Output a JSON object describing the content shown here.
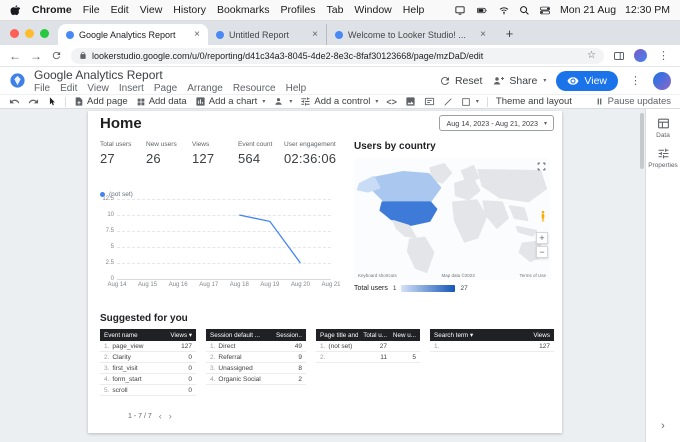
{
  "theme": {
    "accent_blue": "#1a73e8",
    "chart_line": "#4285f4",
    "map_us": "#3e7bd8",
    "map_canada": "#aac8ef",
    "map_alaska": "#c9dcf5",
    "map_land": "#e3e5e8",
    "table_header_bg": "#202124"
  },
  "menubar": {
    "items": [
      "Chrome",
      "File",
      "Edit",
      "View",
      "History",
      "Bookmarks",
      "Profiles",
      "Tab",
      "Window",
      "Help"
    ],
    "date": "Mon 21 Aug",
    "time": "12:30 PM"
  },
  "browser": {
    "tabs": [
      {
        "title": "Google Analytics Report"
      },
      {
        "title": "Untitled Report"
      },
      {
        "title": "Welcome to Looker Studio! ..."
      }
    ],
    "url": "lookerstudio.google.com/u/0/reporting/d41c34a3-8045-4de2-8e3c-8faf30123668/page/mzDaD/edit"
  },
  "header": {
    "title": "Google Analytics Report",
    "menus": [
      "File",
      "Edit",
      "View",
      "Insert",
      "Page",
      "Arrange",
      "Resource",
      "Help"
    ],
    "reset_label": "Reset",
    "share_label": "Share",
    "view_label": "View"
  },
  "toolbar": {
    "add_page": "Add page",
    "add_data": "Add data",
    "add_chart": "Add a chart",
    "add_control": "Add a control",
    "theme_layout": "Theme and layout",
    "pause_updates": "Pause updates"
  },
  "canvas": {
    "page_title": "Home",
    "date_range": "Aug 14, 2023 - Aug 21, 2023"
  },
  "scorecards": [
    {
      "label": "Total users",
      "value": "27"
    },
    {
      "label": "New users",
      "value": "26"
    },
    {
      "label": "Views",
      "value": "127"
    },
    {
      "label": "Event count",
      "value": "564"
    },
    {
      "label": "User engagement",
      "value": "02:36:06"
    }
  ],
  "map": {
    "title": "Users by country",
    "legend_label": "Total users",
    "legend_min": "1",
    "legend_max": "27",
    "attr_shortcuts": "Keyboard shortcuts",
    "attr_data": "Map data ©2023",
    "attr_terms": "Terms of Use"
  },
  "suggested": {
    "title": "Suggested for you",
    "pagination": "1 - 7 / 7",
    "tables": [
      {
        "headers": [
          "Event name",
          "Views ▾"
        ],
        "rows": [
          [
            "page_view",
            "127"
          ],
          [
            "Clarity",
            "0"
          ],
          [
            "first_visit",
            "0"
          ],
          [
            "form_start",
            "0"
          ],
          [
            "scroll",
            "0"
          ]
        ]
      },
      {
        "headers": [
          "Session default ...",
          "Session..."
        ],
        "rows": [
          [
            "Direct",
            "49"
          ],
          [
            "Referral",
            "9"
          ],
          [
            "Unassigned",
            "8"
          ],
          [
            "Organic Social",
            "2"
          ]
        ]
      },
      {
        "headers": [
          "Page title and s...",
          "Total u...",
          "New u..."
        ],
        "rows": [
          [
            "(not set)",
            "27",
            ""
          ],
          [
            "",
            "11",
            "5"
          ]
        ]
      },
      {
        "headers": [
          "Search term ▾",
          "Views"
        ],
        "rows": [
          [
            "",
            "127"
          ]
        ]
      }
    ]
  },
  "side_panel": {
    "data_label": "Data",
    "properties_label": "Properties"
  },
  "chart_data": [
    {
      "type": "line",
      "title": "",
      "legend": [
        "(not set)"
      ],
      "x": [
        "Aug 14",
        "Aug 15",
        "Aug 16",
        "Aug 17",
        "Aug 18",
        "Aug 19",
        "Aug 20",
        "Aug 21"
      ],
      "series": [
        {
          "name": "(not set)",
          "values": [
            null,
            null,
            null,
            null,
            10,
            9,
            2.5,
            null
          ]
        }
      ],
      "ylim": [
        0,
        12.5
      ],
      "yticks": [
        0,
        2.5,
        5,
        7.5,
        10,
        12.5
      ],
      "grid": true,
      "legend_position": "top-left"
    },
    {
      "type": "heatmap",
      "subtype": "geo-choropleth",
      "title": "Users by country",
      "legend": {
        "label": "Total users",
        "min": 1,
        "max": 27
      },
      "regions": [
        {
          "country": "United States",
          "shade": "dark-blue (max)"
        },
        {
          "country": "Canada",
          "shade": "light-blue"
        }
      ]
    }
  ]
}
